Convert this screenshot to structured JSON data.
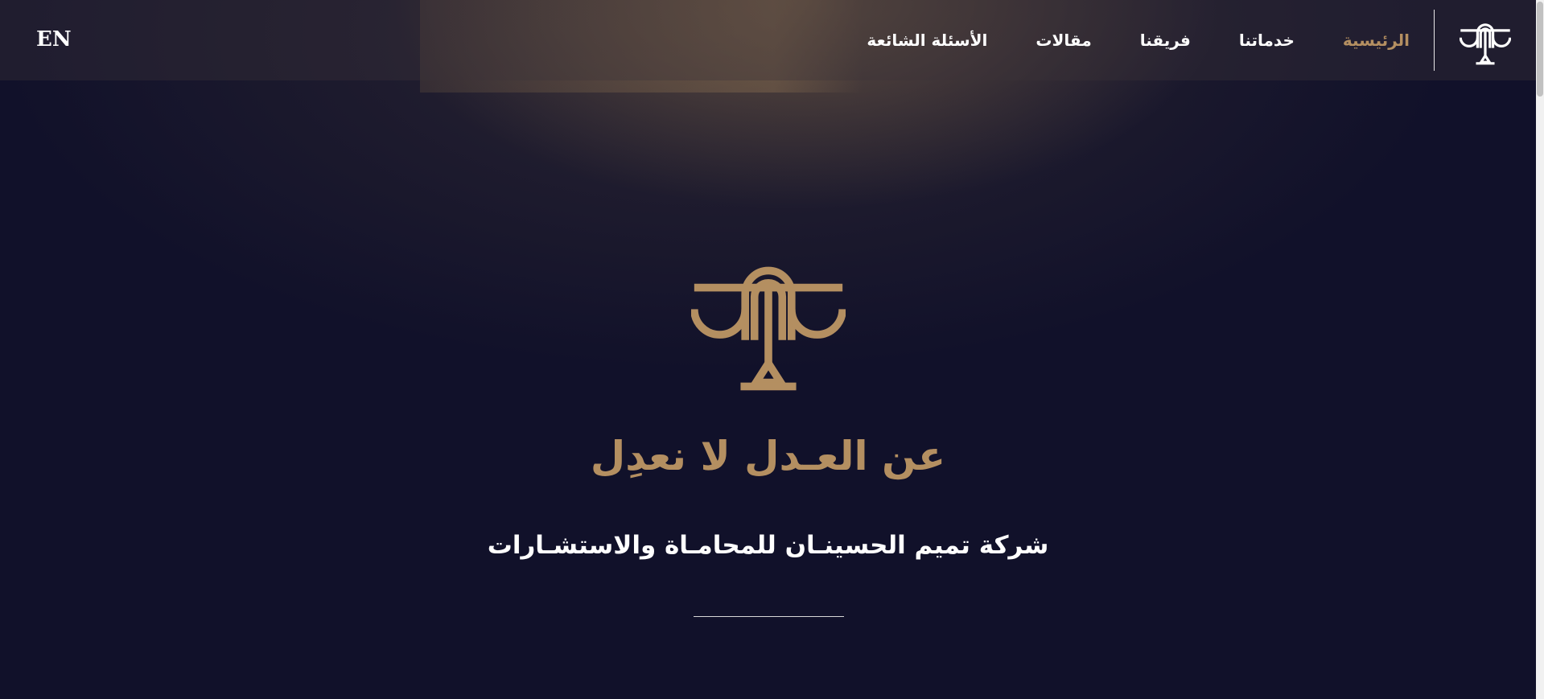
{
  "colors": {
    "background": "#11112a",
    "accent_gold": "#b48f61",
    "text_white": "#ffffff"
  },
  "header": {
    "logo_icon": "scales-of-justice-icon",
    "nav": [
      {
        "label": "الرئيسية",
        "active": true
      },
      {
        "label": "خدماتنا",
        "active": false
      },
      {
        "label": "فريقنا",
        "active": false
      },
      {
        "label": "مقالات",
        "active": false
      },
      {
        "label": "الأسئلة الشائعة",
        "active": false
      }
    ],
    "language_toggle": "EN"
  },
  "hero": {
    "logo_icon": "scales-of-justice-icon",
    "title": "عن العـدل لا نعدِل",
    "subtitle": "شركة تميم الحسينـان للمحامـاة والاستشـارات"
  }
}
